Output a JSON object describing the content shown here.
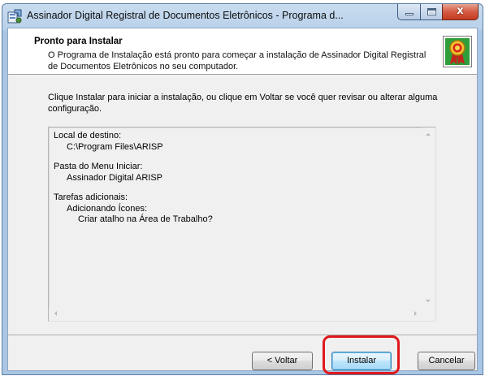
{
  "window": {
    "title": "Assinador Digital Registral de Documentos Eletrônicos - Programa d...",
    "close_glyph": "x"
  },
  "header": {
    "title": "Pronto para Instalar",
    "description": "O Programa de Instalação está pronto para começar a instalação de Assinador Digital Registral de Documentos Eletrônicos no seu computador."
  },
  "instruction": "Clique Instalar para iniciar a instalação, ou clique em Voltar se você quer revisar ou alterar alguma configuração.",
  "summary": {
    "destination_label": "Local de destino:",
    "destination_value": "C:\\Program Files\\ARISP",
    "start_menu_label": "Pasta do Menu Iniciar:",
    "start_menu_value": "Assinador Digital ARISP",
    "tasks_label": "Tarefas adicionais:",
    "tasks_group": "Adicionando Ícones:",
    "tasks_item": "Criar atalho na Área de Trabalho?"
  },
  "buttons": {
    "back": "< Voltar",
    "install": "Instalar",
    "cancel": "Cancelar"
  },
  "colors": {
    "highlight": "#e0181d",
    "titlebar": "#b9d1ea",
    "close_button": "#c43a1e"
  },
  "icons": {
    "app": "installer-app-icon",
    "header": "award-ribbon-icon",
    "minimize": "minimize-icon",
    "maximize": "maximize-icon",
    "close": "close-icon"
  }
}
